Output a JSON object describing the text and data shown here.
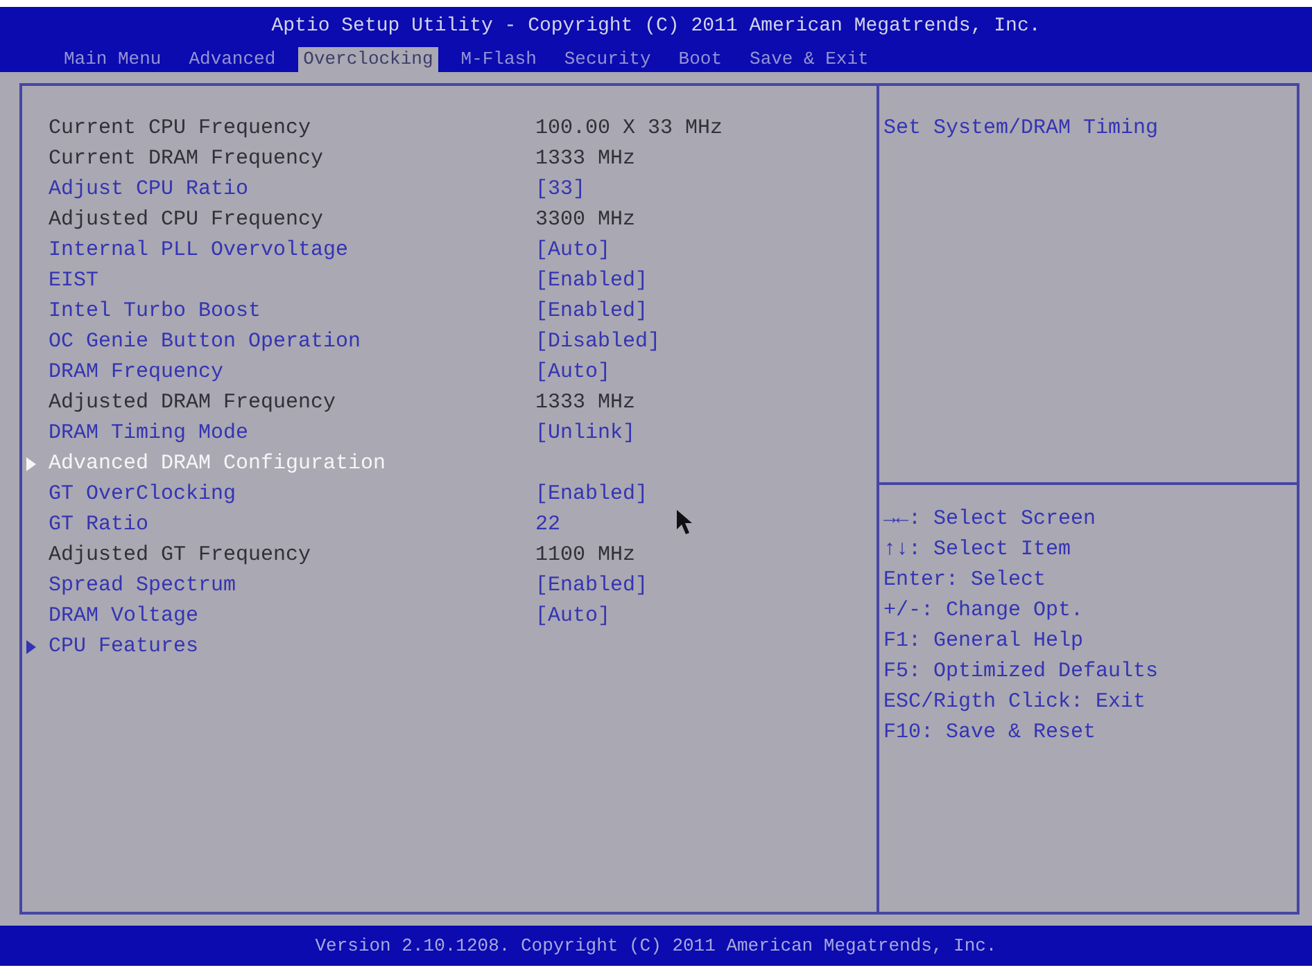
{
  "header": {
    "title": "Aptio Setup Utility - Copyright (C) 2011 American Megatrends, Inc."
  },
  "tabs": [
    {
      "label": "Main Menu",
      "selected": false
    },
    {
      "label": "Advanced",
      "selected": false
    },
    {
      "label": "Overclocking",
      "selected": true
    },
    {
      "label": "M-Flash",
      "selected": false
    },
    {
      "label": "Security",
      "selected": false
    },
    {
      "label": "Boot",
      "selected": false
    },
    {
      "label": "Save & Exit",
      "selected": false
    }
  ],
  "settings": [
    {
      "kind": "info",
      "label": "Current CPU Frequency",
      "value": "100.00 X 33 MHz",
      "selected": false
    },
    {
      "kind": "info",
      "label": "Current DRAM Frequency",
      "value": "1333 MHz",
      "selected": false
    },
    {
      "kind": "option",
      "label": "Adjust CPU Ratio",
      "value": "[33]",
      "selected": false
    },
    {
      "kind": "info",
      "label": "Adjusted CPU Frequency",
      "value": "3300 MHz",
      "selected": false
    },
    {
      "kind": "option",
      "label": "Internal PLL Overvoltage",
      "value": "[Auto]",
      "selected": false
    },
    {
      "kind": "option",
      "label": "EIST",
      "value": "[Enabled]",
      "selected": false
    },
    {
      "kind": "option",
      "label": "Intel Turbo Boost",
      "value": "[Enabled]",
      "selected": false
    },
    {
      "kind": "option",
      "label": "OC Genie Button Operation",
      "value": "[Disabled]",
      "selected": false
    },
    {
      "kind": "option",
      "label": "DRAM Frequency",
      "value": "[Auto]",
      "selected": false
    },
    {
      "kind": "info",
      "label": "Adjusted DRAM Frequency",
      "value": "1333 MHz",
      "selected": false
    },
    {
      "kind": "option",
      "label": "DRAM Timing Mode",
      "value": "[Unlink]",
      "selected": false
    },
    {
      "kind": "submenu",
      "label": "Advanced DRAM Configuration",
      "selected": true
    },
    {
      "kind": "option",
      "label": "GT OverClocking",
      "value": "[Enabled]",
      "selected": false
    },
    {
      "kind": "option",
      "label": "GT Ratio",
      "value": "22",
      "selected": false
    },
    {
      "kind": "info",
      "label": "Adjusted GT Frequency",
      "value": "1100 MHz",
      "selected": false
    },
    {
      "kind": "option",
      "label": "Spread Spectrum",
      "value": "[Enabled]",
      "selected": false
    },
    {
      "kind": "option",
      "label": "DRAM Voltage",
      "value": "[Auto]",
      "selected": false
    },
    {
      "kind": "submenu",
      "label": "CPU Features",
      "selected": false
    }
  ],
  "help": {
    "text": "Set System/DRAM Timing"
  },
  "keys": [
    "→←: Select Screen",
    "↑↓: Select Item",
    "Enter: Select",
    "+/-: Change Opt.",
    "F1: General Help",
    "F5: Optimized Defaults",
    "ESC/Rigth Click: Exit",
    "F10: Save & Reset"
  ],
  "footer": {
    "text": "Version 2.10.1208. Copyright (C) 2011 American Megatrends, Inc."
  }
}
